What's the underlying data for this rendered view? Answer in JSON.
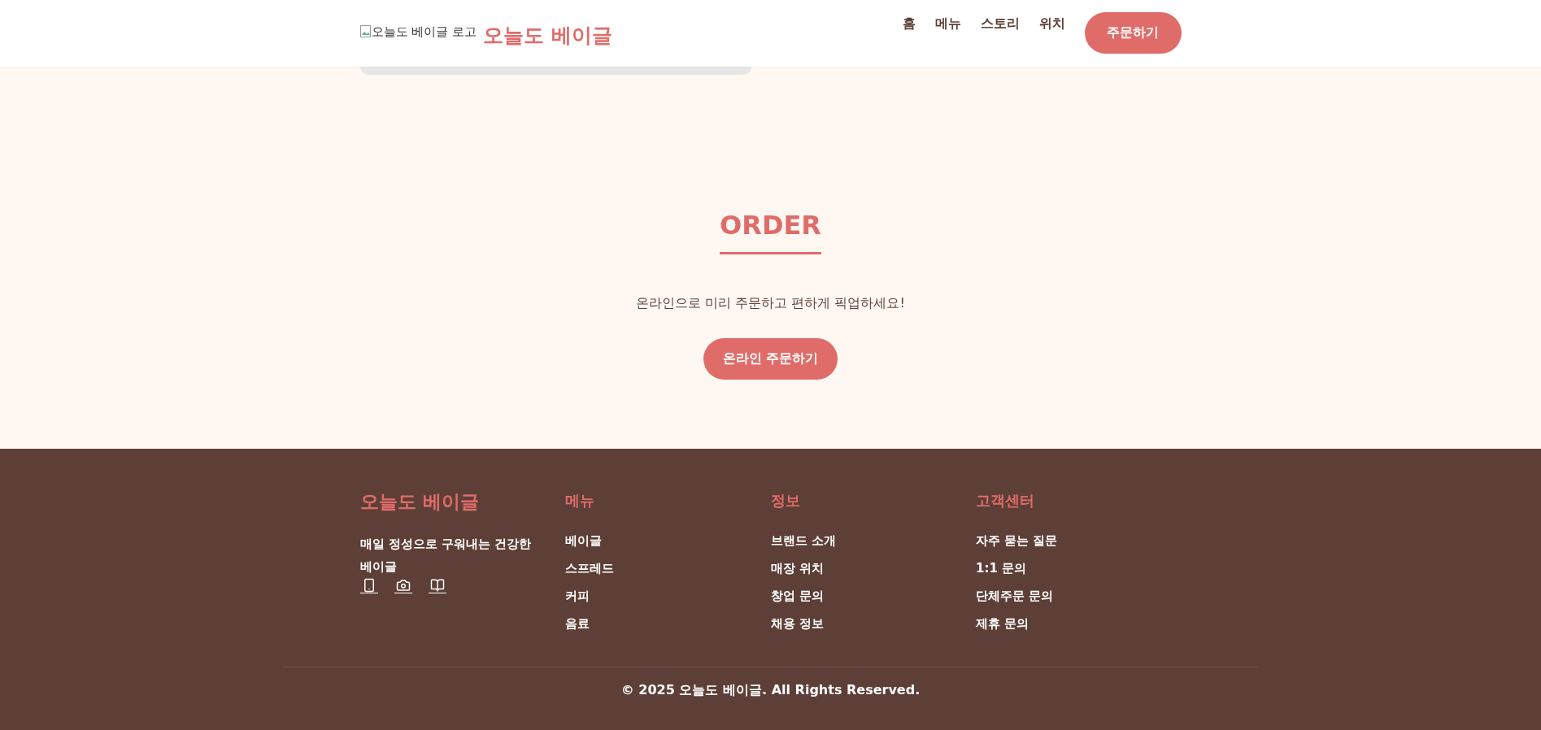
{
  "header": {
    "logo_alt": "오늘도 베이글 로고",
    "brand": "오늘도 베이글",
    "nav": [
      {
        "label": "홈"
      },
      {
        "label": "메뉴"
      },
      {
        "label": "스토리"
      },
      {
        "label": "위치"
      }
    ],
    "cta": "주문하기"
  },
  "order": {
    "title": "ORDER",
    "text": "온라인으로 미리 주문하고 편하게 픽업하세요!",
    "button": "온라인 주문하기"
  },
  "footer": {
    "brand": "오늘도 베이글",
    "tagline": "매일 정성으로 구워내는 건강한 베이글",
    "social": [
      {
        "kind": "phone"
      },
      {
        "kind": "camera"
      },
      {
        "kind": "book"
      }
    ],
    "columns": [
      {
        "title": "메뉴",
        "links": [
          "베이글",
          "스프레드",
          "커피",
          "음료"
        ]
      },
      {
        "title": "정보",
        "links": [
          "브랜드 소개",
          "매장 위치",
          "창업 문의",
          "채용 정보"
        ]
      },
      {
        "title": "고객센터",
        "links": [
          "자주 묻는 질문",
          "1:1 문의",
          "단체주문 문의",
          "제휴 문의"
        ]
      }
    ],
    "copyright": "© 2025 오늘도 베이글. All Rights Reserved."
  }
}
